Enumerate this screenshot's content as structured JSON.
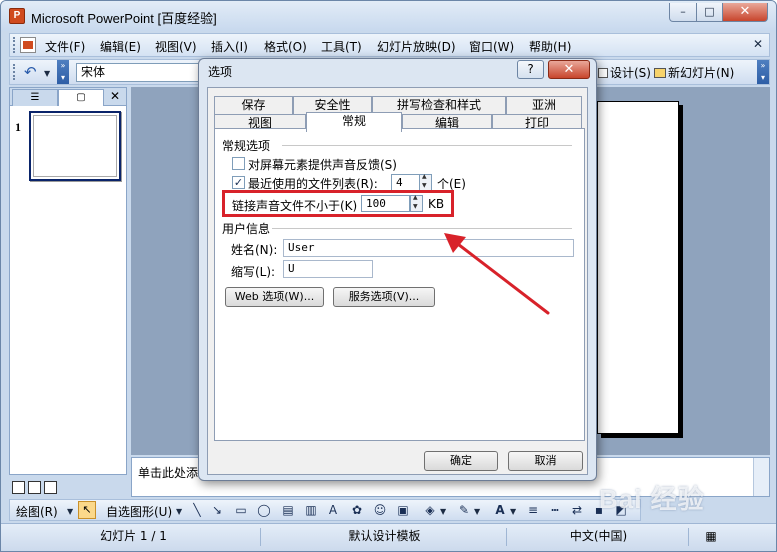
{
  "window": {
    "app_name": "Microsoft PowerPoint",
    "doc_title": "[百度经验]",
    "minimize": "–",
    "maximize": "□",
    "close": "✕"
  },
  "menubar": {
    "items": [
      "文件(F)",
      "编辑(E)",
      "视图(V)",
      "插入(I)",
      "格式(O)",
      "工具(T)",
      "幻灯片放映(D)",
      "窗口(W)",
      "帮助(H)"
    ],
    "close_doc": "✕"
  },
  "toolbar": {
    "font": "宋体",
    "design_label": "设计(S)",
    "new_slide_label": "新幻灯片(N)"
  },
  "left_pane": {
    "close": "✕",
    "slide_number": "1"
  },
  "notes": {
    "placeholder": "单击此处添"
  },
  "drawbar": {
    "draw_label": "绘图(R)",
    "autoshape_label": "自选图形(U)"
  },
  "statusbar": {
    "slide": "幻灯片 1 / 1",
    "template": "默认设计模板",
    "language": "中文(中国)"
  },
  "watermark": "Bai 经验",
  "dialog": {
    "title": "选项",
    "help": "?",
    "close": "✕",
    "tabs_row1": [
      "保存",
      "安全性",
      "拼写检查和样式",
      "亚洲"
    ],
    "tabs_row2": [
      "视图",
      "常规",
      "编辑",
      "打印"
    ],
    "active_tab": "常规",
    "general": {
      "section_title": "常规选项",
      "sound_feedback": {
        "label": "对屏幕元素提供声音反馈(S)",
        "checked": false
      },
      "recent_files": {
        "label": "最近使用的文件列表(R):",
        "checked": true,
        "value": "4",
        "unit": "个(E)"
      },
      "link_sounds": {
        "label": "链接声音文件不小于(K)",
        "value": "100",
        "unit": "KB"
      }
    },
    "user_info": {
      "section_title": "用户信息",
      "name_label": "姓名(N):",
      "name_value": "User",
      "initials_label": "缩写(L):",
      "initials_value": "U"
    },
    "buttons": {
      "web_options": "Web 选项(W)...",
      "service_options": "服务选项(V)...",
      "ok": "确定",
      "cancel": "取消"
    }
  },
  "colors": {
    "accent_red": "#d8222a",
    "title_bar": "#c8d9ee",
    "workspace": "#8fa3bd"
  }
}
